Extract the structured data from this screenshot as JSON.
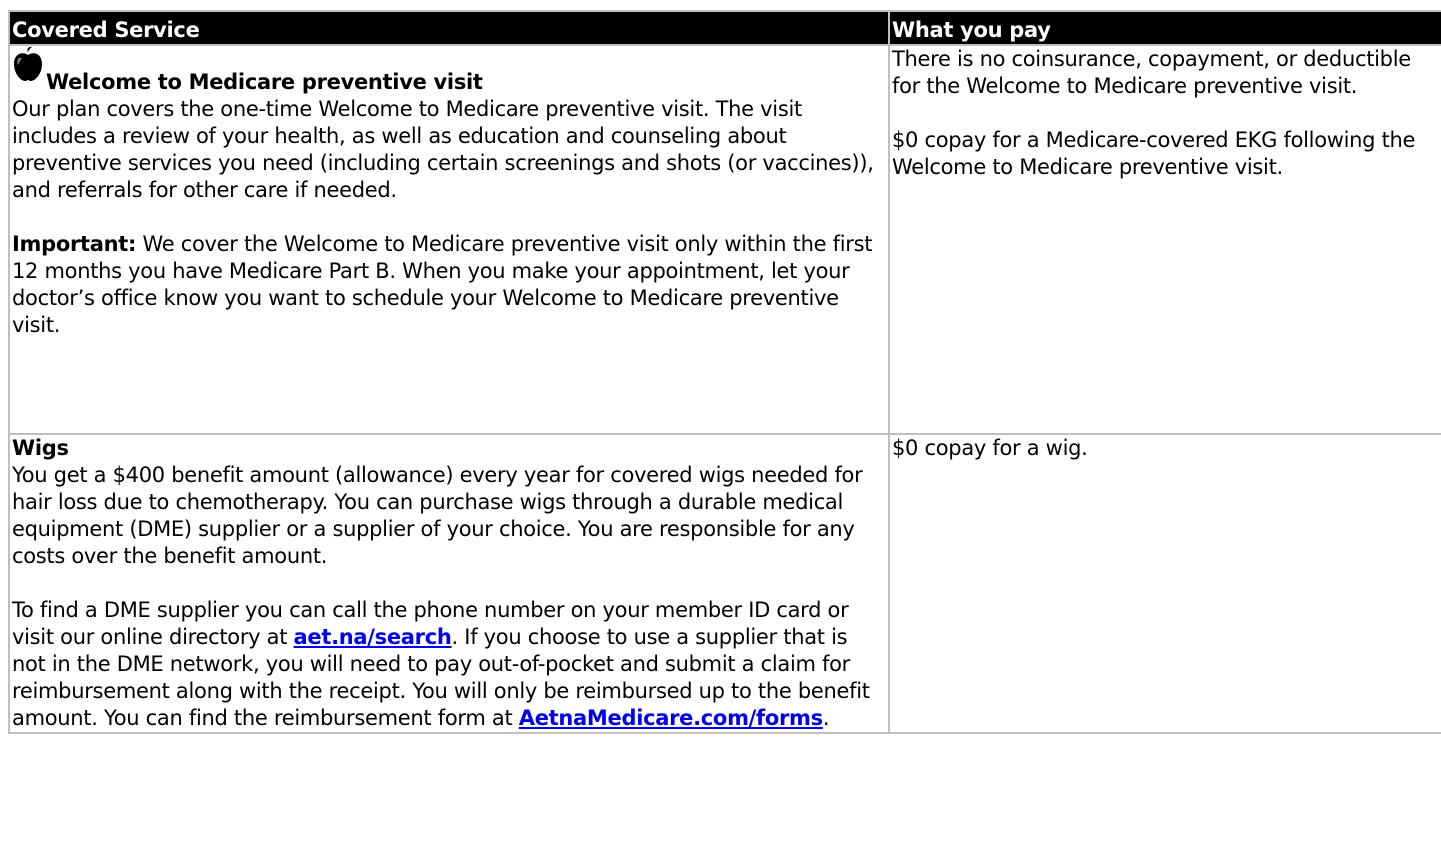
{
  "table": {
    "header": {
      "col1": "Covered Service",
      "col2": "What you pay"
    },
    "rows": [
      {
        "icon": "apple-icon",
        "title": "Welcome to Medicare preventive visit",
        "description": "Our plan covers the one-time Welcome to Medicare preventive visit. The visit includes a review of your health, as well as education and counseling about preventive services you need (including certain screenings and shots (or vaccines)), and referrals for other care if needed.",
        "important_label": "Important:",
        "important_text": " We cover the Welcome to Medicare preventive visit only within the first 12 months you have Medicare Part B. When you make your appointment, let your doctor’s office know you want to schedule your Welcome to Medicare preventive visit.",
        "pay_1": "There is no coinsurance, copayment, or deductible for the Welcome to Medicare preventive visit.",
        "pay_2": "$0 copay for a Medicare-covered EKG following the Welcome to Medicare preventive visit."
      },
      {
        "title": "Wigs",
        "description": "You get a $400 benefit amount (allowance) every year for covered wigs needed for hair loss due to chemotherapy. You can purchase wigs through a durable medical equipment (DME) supplier or a supplier of your choice. You are responsible for any costs over the benefit amount.",
        "para2_before_link1": "To find a DME supplier you can call the phone number on your member ID card or visit our online directory at ",
        "link1": "aet.na/search",
        "para2_between_links": ". If you choose to use a supplier that is not in the DME network, you will need to pay out-of-pocket and submit a claim for reimbursement along with the receipt. You will only be reimbursed up to the benefit amount. You can find the reimbursement form at ",
        "link2": "AetnaMedicare.com/forms",
        "para2_after_link2": ".",
        "pay_1": "$0 copay for a wig."
      }
    ]
  }
}
